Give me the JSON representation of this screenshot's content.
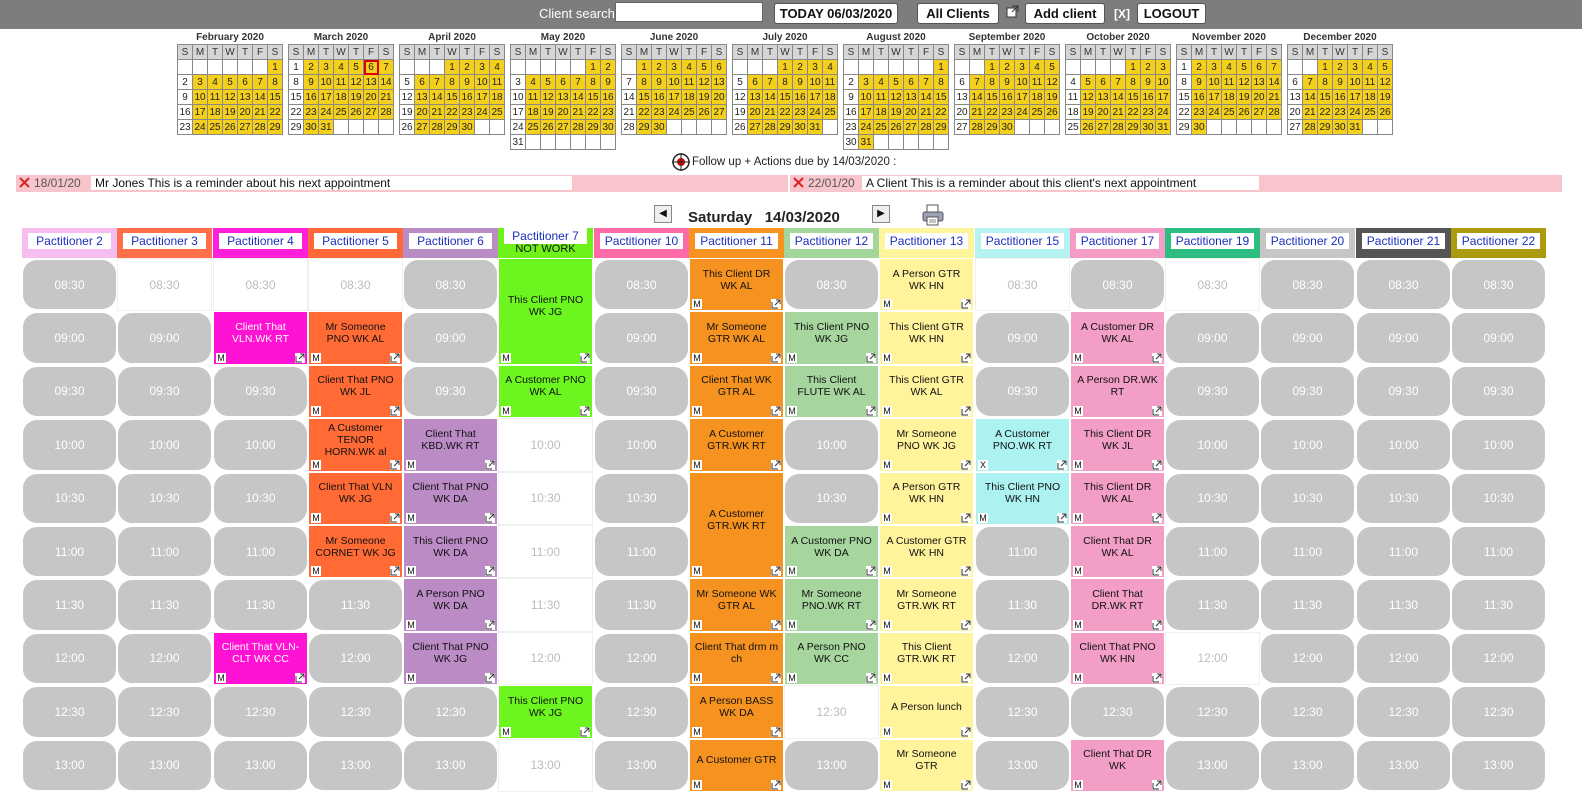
{
  "topbar": {
    "search_label": "Client search",
    "search_value": "",
    "today_label": "TODAY 06/03/2020",
    "all_clients_label": "All Clients",
    "add_client_label": "Add client",
    "close_label": "[X]",
    "logout_label": "LOGOUT"
  },
  "weekday_headers": [
    "S",
    "M",
    "T",
    "W",
    "T",
    "F",
    "S"
  ],
  "months": [
    {
      "title": "February 2020",
      "first": 6,
      "days": 29,
      "sel": 0
    },
    {
      "title": "March 2020",
      "first": 0,
      "days": 31,
      "sel": 6
    },
    {
      "title": "April 2020",
      "first": 3,
      "days": 30,
      "sel": 0
    },
    {
      "title": "May 2020",
      "first": 5,
      "days": 31,
      "sel": 0
    },
    {
      "title": "June 2020",
      "first": 1,
      "days": 30,
      "sel": 0
    },
    {
      "title": "July 2020",
      "first": 3,
      "days": 31,
      "sel": 0
    },
    {
      "title": "August 2020",
      "first": 6,
      "days": 31,
      "sel": 0
    },
    {
      "title": "September 2020",
      "first": 2,
      "days": 30,
      "sel": 0
    },
    {
      "title": "October 2020",
      "first": 4,
      "days": 31,
      "sel": 0
    },
    {
      "title": "November 2020",
      "first": 0,
      "days": 30,
      "sel": 0
    },
    {
      "title": "December 2020",
      "first": 2,
      "days": 31,
      "sel": 0
    }
  ],
  "followup": {
    "text": "Follow up + Actions due by 14/03/2020 :"
  },
  "reminders": [
    {
      "date": "18/01/20",
      "text": "Mr Jones This is a reminder about his next appointment"
    },
    {
      "date": "22/01/20",
      "text": "A Client This is a reminder about this client's next appointment"
    }
  ],
  "day": {
    "weekday": "Saturday",
    "date": "14/03/2020",
    "prev_label": "◀",
    "next_label": "▶"
  },
  "times": [
    "08:30",
    "09:00",
    "09:30",
    "10:00",
    "10:30",
    "11:00",
    "11:30",
    "12:00",
    "12:30",
    "13:00"
  ],
  "columns": [
    {
      "name": "Pactitioner 2",
      "color": "#f5bdf0",
      "slots": [
        [
          "f"
        ],
        [
          "f"
        ],
        [
          "f"
        ],
        [
          "f"
        ],
        [
          "f"
        ],
        [
          "f"
        ],
        [
          "f"
        ],
        [
          "f"
        ],
        [
          "f"
        ],
        [
          "f"
        ]
      ]
    },
    {
      "name": "Pactitioner 3",
      "color": "#ff6f4a",
      "slots": [
        [
          "o"
        ],
        [
          "f"
        ],
        [
          "f"
        ],
        [
          "f"
        ],
        [
          "f"
        ],
        [
          "f"
        ],
        [
          "f"
        ],
        [
          "f"
        ],
        [
          "f"
        ],
        [
          "f"
        ]
      ]
    },
    {
      "name": "Pactitioner 4",
      "color": "#ff1fd8",
      "slots": [
        [
          "o"
        ],
        [
          "a",
          "Client That VLN.WK RT",
          "#ff12d4",
          1,
          "M",
          1
        ],
        [
          "f"
        ],
        [
          "f"
        ],
        [
          "f"
        ],
        [
          "f"
        ],
        [
          "f"
        ],
        [
          "a",
          "Client That VLN-CLT WK CC",
          "#ff12d4",
          1,
          "M",
          1
        ],
        [
          "f"
        ],
        [
          "f"
        ]
      ]
    },
    {
      "name": "Pactitioner 5",
      "color": "#ff6838",
      "slots": [
        [
          "o"
        ],
        [
          "a",
          "Mr Someone PNO WK AL",
          "#ff6a35",
          1,
          "M",
          1
        ],
        [
          "a",
          "Client That PNO WK JL",
          "#ff6a35",
          1,
          "M",
          1
        ],
        [
          "a",
          "A Customer TENOR HORN.WK al",
          "#ff6a35",
          1,
          "M",
          1
        ],
        [
          "a",
          "Client That VLN WK JG",
          "#ff6a35",
          1,
          "M",
          1
        ],
        [
          "a",
          "Mr Someone CORNET WK JG",
          "#ff6a35",
          1,
          "M",
          1
        ],
        [
          "f"
        ],
        [
          "f"
        ],
        [
          "f"
        ],
        [
          "f"
        ]
      ]
    },
    {
      "name": "Pactitioner 6",
      "color": "#b98cc3",
      "slots": [
        [
          "f"
        ],
        [
          "f"
        ],
        [
          "f"
        ],
        [
          "a",
          "Client That KBD.WK RT",
          "#bb8bc6",
          1,
          "M",
          1
        ],
        [
          "a",
          "Client That PNO WK DA",
          "#bb8bc6",
          1,
          "M",
          1
        ],
        [
          "a",
          "This Client PNO WK DA",
          "#bb8bc6",
          1,
          "M",
          1
        ],
        [
          "a",
          "A Person PNO WK DA",
          "#bb8bc6",
          1,
          "M",
          1
        ],
        [
          "a",
          "Client That PNO WK JG",
          "#bb8bc6",
          1,
          "M",
          1
        ],
        [
          "f"
        ],
        [
          "f"
        ]
      ]
    },
    {
      "name": "Pactitioner 7",
      "note": "NOT WORK",
      "color": "#6ff21a",
      "slots": [
        [
          "a",
          "This Client PNO WK JG",
          "#6cf51e",
          2,
          "M",
          1
        ],
        [],
        [
          "a",
          "A Customer PNO WK AL",
          "#6cf51e",
          1,
          "M",
          1
        ],
        [
          "o"
        ],
        [
          "o"
        ],
        [
          "o"
        ],
        [
          "o"
        ],
        [
          "o"
        ],
        [
          "a",
          "This Client PNO WK JG",
          "#6cf51e",
          1,
          "M",
          1
        ],
        [
          "o"
        ]
      ]
    },
    {
      "name": "Pactitioner 10",
      "color": "#ff6aa8",
      "slots": [
        [
          "f"
        ],
        [
          "f"
        ],
        [
          "f"
        ],
        [
          "f"
        ],
        [
          "f"
        ],
        [
          "f"
        ],
        [
          "f"
        ],
        [
          "f"
        ],
        [
          "f"
        ],
        [
          "f"
        ]
      ]
    },
    {
      "name": "Pactitioner 11",
      "color": "#f79320",
      "slots": [
        [
          "a",
          "This Client DR WK AL",
          "#f6921f",
          1,
          "M",
          1
        ],
        [
          "a",
          "Mr Someone GTR WK AL",
          "#f6921f",
          1,
          "M",
          1
        ],
        [
          "a",
          "Client That WK GTR AL",
          "#f6921f",
          1,
          "M",
          1
        ],
        [
          "a",
          "A Customer GTR.WK RT",
          "#f6921f",
          1,
          "M",
          1
        ],
        [
          "a",
          "A Customer GTR.WK RT",
          "#f6921f",
          2,
          "M",
          1
        ],
        [],
        [
          "a",
          "Mr Someone WK GTR AL",
          "#f6921f",
          1,
          "M",
          1
        ],
        [
          "a",
          "Client That drm m ch",
          "#f6921f",
          1,
          "M",
          1
        ],
        [
          "a",
          "A Person BASS WK DA",
          "#f6921f",
          1,
          "M",
          1
        ],
        [
          "a",
          "A Customer GTR",
          "#f6921f",
          1,
          "M",
          1
        ]
      ]
    },
    {
      "name": "Pactitioner 12",
      "color": "#a3d69b",
      "slots": [
        [
          "f"
        ],
        [
          "a",
          "This Client PNO WK JG",
          "#a6d59e",
          1,
          "M",
          1
        ],
        [
          "a",
          "This Client FLUTE WK AL",
          "#a6d59e",
          1,
          "M",
          1
        ],
        [
          "f"
        ],
        [
          "f"
        ],
        [
          "a",
          "A Customer PNO WK DA",
          "#a6d59e",
          1,
          "M",
          1
        ],
        [
          "a",
          "Mr Someone PNO.WK RT",
          "#a6d59e",
          1,
          "M",
          1
        ],
        [
          "a",
          "A Person PNO WK CC",
          "#a6d59e",
          1,
          "M",
          1
        ],
        [
          "o"
        ],
        [
          "f"
        ]
      ]
    },
    {
      "name": "Pactitioner 13",
      "color": "#fff59a",
      "slots": [
        [
          "a",
          "A Person GTR WK HN",
          "#fff39b",
          1,
          "M",
          1
        ],
        [
          "a",
          "This Client GTR WK HN",
          "#fff39b",
          1,
          "M",
          1
        ],
        [
          "a",
          "This Client GTR WK AL",
          "#fff39b",
          1,
          "M",
          1
        ],
        [
          "a",
          "Mr Someone PNO WK JG",
          "#fff39b",
          1,
          "M",
          1
        ],
        [
          "a",
          "A Person GTR WK HN",
          "#fff39b",
          1,
          "M",
          1
        ],
        [
          "a",
          "A Customer GTR WK HN",
          "#fff39b",
          1,
          "M",
          1
        ],
        [
          "a",
          "Mr Someone GTR.WK RT",
          "#fff39b",
          1,
          "M",
          1
        ],
        [
          "a",
          "This Client GTR.WK RT",
          "#fff39b",
          1,
          "M",
          1
        ],
        [
          "a",
          "A Person lunch",
          "#fff39b",
          1,
          "M",
          1
        ],
        [
          "a",
          "Mr Someone GTR",
          "#fff39b",
          1,
          "M",
          1
        ]
      ]
    },
    {
      "name": "Pactitioner 15",
      "color": "#b4f3f1",
      "slots": [
        [
          "o"
        ],
        [
          "f"
        ],
        [
          "f"
        ],
        [
          "a",
          "A Customer PNO.WK RT",
          "#acf2f0",
          1,
          "X",
          1
        ],
        [
          "a",
          "This Client PNO WK HN",
          "#acf2f0",
          1,
          "M",
          1
        ],
        [
          "f"
        ],
        [
          "f"
        ],
        [
          "f"
        ],
        [
          "f"
        ],
        [
          "f"
        ]
      ]
    },
    {
      "name": "Pactitioner 17",
      "color": "#f49cc6",
      "slots": [
        [
          "f"
        ],
        [
          "a",
          "A Customer DR WK AL",
          "#f29ec7",
          1,
          "M",
          1
        ],
        [
          "a",
          "A Person DR.WK RT",
          "#f29ec7",
          1,
          "M",
          1
        ],
        [
          "a",
          "This Client DR WK JL",
          "#f29ec7",
          1,
          "M",
          1
        ],
        [
          "a",
          "This Client DR WK AL",
          "#f29ec7",
          1,
          "M",
          1
        ],
        [
          "a",
          "Client That DR WK AL",
          "#f29ec7",
          1,
          "M",
          1
        ],
        [
          "a",
          "Client That DR.WK RT",
          "#f29ec7",
          1,
          "M",
          1
        ],
        [
          "a",
          "Client That PNO WK HN",
          "#f29ec7",
          1,
          "M",
          1
        ],
        [
          "f"
        ],
        [
          "a",
          "Client That DR WK",
          "#f29ec7",
          1,
          "M",
          1
        ]
      ]
    },
    {
      "name": "Pactitioner 19",
      "color": "#2ebd80",
      "slots": [
        [
          "o"
        ],
        [
          "f"
        ],
        [
          "f"
        ],
        [
          "f"
        ],
        [
          "f"
        ],
        [
          "f"
        ],
        [
          "f"
        ],
        [
          "o"
        ],
        [
          "f"
        ],
        [
          "f"
        ]
      ]
    },
    {
      "name": "Pactitioner 20",
      "color": "#c6c6c6",
      "slots": [
        [
          "f"
        ],
        [
          "f"
        ],
        [
          "f"
        ],
        [
          "f"
        ],
        [
          "f"
        ],
        [
          "f"
        ],
        [
          "f"
        ],
        [
          "f"
        ],
        [
          "f"
        ],
        [
          "f"
        ]
      ]
    },
    {
      "name": "Pactitioner 21",
      "color": "#555555",
      "slots": [
        [
          "f"
        ],
        [
          "f"
        ],
        [
          "f"
        ],
        [
          "f"
        ],
        [
          "f"
        ],
        [
          "f"
        ],
        [
          "f"
        ],
        [
          "f"
        ],
        [
          "f"
        ],
        [
          "f"
        ]
      ]
    },
    {
      "name": "Pactitioner 22",
      "color": "#ab9a0e",
      "slots": [
        [
          "f"
        ],
        [
          "f"
        ],
        [
          "f"
        ],
        [
          "f"
        ],
        [
          "f"
        ],
        [
          "f"
        ],
        [
          "f"
        ],
        [
          "f"
        ],
        [
          "f"
        ],
        [
          "f"
        ]
      ]
    }
  ]
}
